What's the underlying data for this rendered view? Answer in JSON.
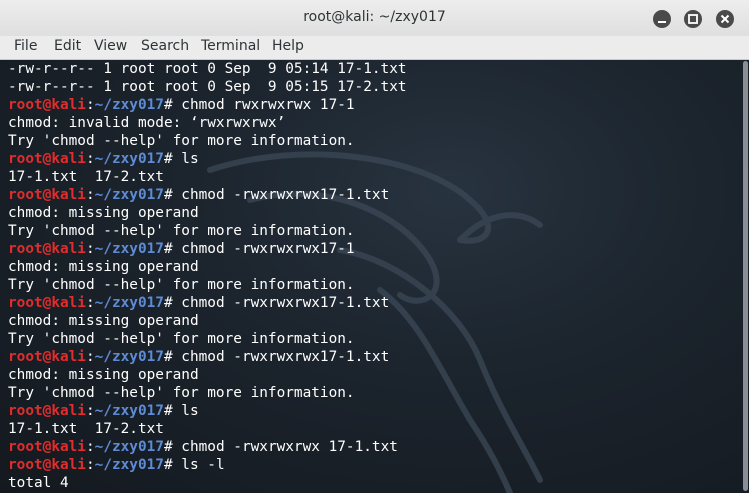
{
  "window": {
    "title": "root@kali: ~/zxy017"
  },
  "menu": [
    "File",
    "Edit",
    "View",
    "Search",
    "Terminal",
    "Help"
  ],
  "prompt": {
    "user_host": "root@kali",
    "sep": ":",
    "path": "~/zxy017",
    "sym": "#"
  },
  "lines": [
    {
      "text": "-rw-r--r-- 1 root root 0 Sep  9 05:14 17-1.txt"
    },
    {
      "text": "-rw-r--r-- 1 root root 0 Sep  9 05:15 17-2.txt"
    },
    {
      "prompt": true,
      "text": " chmod rwxrwxrwx 17-1"
    },
    {
      "text": "chmod: invalid mode: ‘rwxrwxrwx’"
    },
    {
      "text": "Try 'chmod --help' for more information."
    },
    {
      "prompt": true,
      "text": " ls"
    },
    {
      "text": "17-1.txt  17-2.txt"
    },
    {
      "prompt": true,
      "text": " chmod -rwxrwxrwx17-1.txt"
    },
    {
      "text": "chmod: missing operand"
    },
    {
      "text": "Try 'chmod --help' for more information."
    },
    {
      "prompt": true,
      "text": " chmod -rwxrwxrwx17-1"
    },
    {
      "text": "chmod: missing operand"
    },
    {
      "text": "Try 'chmod --help' for more information."
    },
    {
      "prompt": true,
      "text": " chmod -rwxrwxrwx17-1.txt"
    },
    {
      "text": "chmod: missing operand"
    },
    {
      "text": "Try 'chmod --help' for more information."
    },
    {
      "prompt": true,
      "text": " chmod -rwxrwxrwx17-1.txt"
    },
    {
      "text": "chmod: missing operand"
    },
    {
      "text": "Try 'chmod --help' for more information."
    },
    {
      "prompt": true,
      "text": " ls"
    },
    {
      "text": "17-1.txt  17-2.txt"
    },
    {
      "prompt": true,
      "text": " chmod -rwxrwxrwx 17-1.txt"
    },
    {
      "prompt": true,
      "text": " ls -l"
    },
    {
      "text": "total 4"
    }
  ],
  "icons": {
    "minimize": "minimize-icon",
    "maximize": "maximize-icon",
    "close": "close-icon"
  },
  "colors": {
    "prompt_user": "#e12d2d",
    "prompt_path": "#5e8bd6",
    "text": "#ffffff",
    "background": "#1b232c"
  }
}
